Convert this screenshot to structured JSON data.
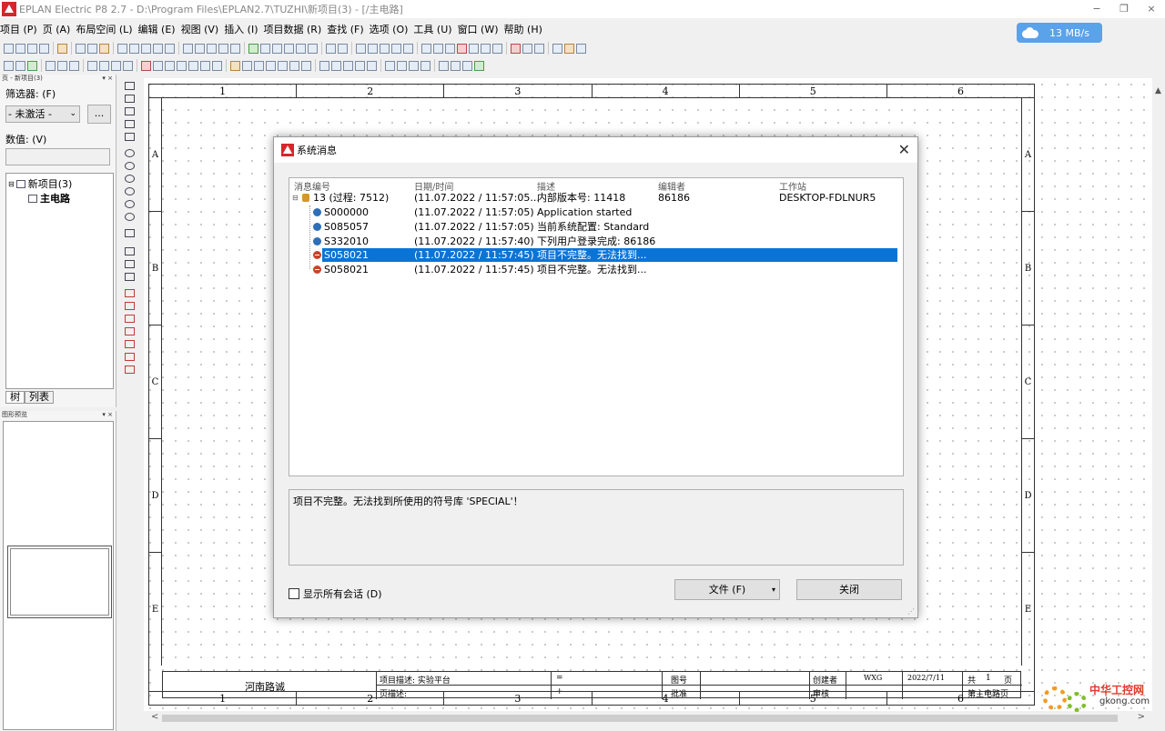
{
  "window": {
    "title": "EPLAN Electric P8 2.7 - D:\\Program Files\\EPLAN2.7\\TUZHI\\新项目(3) - [/主电路]",
    "net_speed": "13 MB/s",
    "min_label": "−",
    "restore_label": "❐",
    "close_label": "×"
  },
  "menu": [
    "项目 (P)",
    "页 (A)",
    "布局空间 (L)",
    "编辑 (E)",
    "视图 (V)",
    "插入 (I)",
    "项目数据 (R)",
    "查找 (F)",
    "选项 (O)",
    "工具 (U)",
    "窗口 (W)",
    "帮助 (H)"
  ],
  "left_panel": {
    "header": "页 - 新项目(3)",
    "filter_label": "筛选器: (F)",
    "filter_value": "- 未激活 -",
    "filter_btn": "...",
    "value_label": "数值: (V)",
    "tree_root": "新项目(3)",
    "tree_child": "主电路",
    "tabs": [
      "树",
      "列表"
    ]
  },
  "preview_panel": {
    "header": "图形预览"
  },
  "drawing": {
    "columns": [
      "1",
      "2",
      "3",
      "4",
      "5",
      "6"
    ],
    "rows": [
      "A",
      "B",
      "C",
      "D",
      "E"
    ],
    "title_block": {
      "company": "河南路诚",
      "proj_desc_label": "项目描述: 实验平台",
      "page_desc_label": "页描述:",
      "eq": "=",
      "plus": "+",
      "drawing_no_label": "图号",
      "approve_label": "批准",
      "creator_label": "创建者",
      "creator_value": "WXG",
      "review_label": "审核",
      "date_value": "2022/7/11",
      "total_label": "共",
      "total_value": "1",
      "page_unit": "页",
      "page_name": "第主电路页"
    }
  },
  "dialog": {
    "title": "系统消息",
    "columns": [
      "消息编号",
      "日期/时间",
      "描述",
      "编辑者",
      "工作站"
    ],
    "rows": [
      {
        "id": "13 (过程: 7512)",
        "datetime": "(11.07.2022 / 11:57:05...",
        "desc": "内部版本号: 11418",
        "editor": "86186",
        "station": "DESKTOP-FDLNUR5",
        "icon": "database-icon",
        "level": 0
      },
      {
        "id": "S000000",
        "datetime": "(11.07.2022 / 11:57:05)",
        "desc": "Application started",
        "editor": "",
        "station": "",
        "icon": "info-icon",
        "level": 1
      },
      {
        "id": "S085057",
        "datetime": "(11.07.2022 / 11:57:05)",
        "desc": "当前系统配置: Standard",
        "editor": "",
        "station": "",
        "icon": "info-icon",
        "level": 1
      },
      {
        "id": "S332010",
        "datetime": "(11.07.2022 / 11:57:40)",
        "desc": "下列用户登录完成: 86186",
        "editor": "",
        "station": "",
        "icon": "info-icon",
        "level": 1
      },
      {
        "id": "S058021",
        "datetime": "(11.07.2022 / 11:57:45)",
        "desc": "项目不完整。无法找到...",
        "editor": "",
        "station": "",
        "icon": "error-icon",
        "level": 1,
        "selected": true
      },
      {
        "id": "S058021",
        "datetime": "(11.07.2022 / 11:57:45)",
        "desc": "项目不完整。无法找到...",
        "editor": "",
        "station": "",
        "icon": "error-icon",
        "level": 1
      }
    ],
    "detail": "项目不完整。无法找到所使用的符号库 'SPECIAL'！",
    "show_all_label": "显示所有会话 (D)",
    "file_btn": "文件 (F)",
    "close_btn": "关闭"
  },
  "watermark": {
    "cn": "中华工控网",
    "site": "gkong.com"
  },
  "colors": {
    "selection": "#0a74d6",
    "brand": "#d7262b",
    "badge": "#5aa2ea"
  }
}
